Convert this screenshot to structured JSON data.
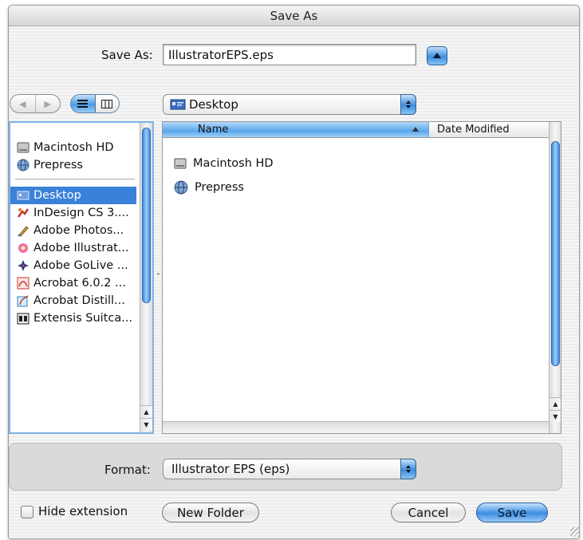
{
  "window": {
    "title": "Save As"
  },
  "save_as": {
    "label": "Save As:",
    "value": "IllustratorEPS.eps"
  },
  "location": {
    "selected": "Desktop"
  },
  "sidebar": {
    "volumes": [
      {
        "label": "Macintosh HD",
        "icon": "hard-drive-icon"
      },
      {
        "label": "Prepress",
        "icon": "network-volume-icon"
      }
    ],
    "places": [
      {
        "label": "Desktop",
        "icon": "desktop-icon",
        "selected": true
      },
      {
        "label": "InDesign CS 3....",
        "icon": "indesign-icon"
      },
      {
        "label": "Adobe Photos...",
        "icon": "photoshop-icon"
      },
      {
        "label": "Adobe Illustrat...",
        "icon": "illustrator-icon"
      },
      {
        "label": "Adobe GoLive ...",
        "icon": "golive-icon"
      },
      {
        "label": "Acrobat 6.0.2 ...",
        "icon": "acrobat-icon"
      },
      {
        "label": "Acrobat Distill...",
        "icon": "distiller-icon"
      },
      {
        "label": "Extensis Suitca...",
        "icon": "suitcase-icon"
      }
    ]
  },
  "browser": {
    "columns": {
      "name": "Name",
      "date_modified": "Date Modified"
    },
    "files": [
      {
        "name": "Macintosh HD",
        "icon": "hard-drive-icon"
      },
      {
        "name": "Prepress",
        "icon": "network-volume-icon"
      }
    ]
  },
  "format": {
    "label": "Format:",
    "selected": "Illustrator EPS (eps)"
  },
  "footer": {
    "hide_extension_label": "Hide extension",
    "hide_extension_checked": false,
    "new_folder_label": "New Folder",
    "cancel_label": "Cancel",
    "save_label": "Save"
  },
  "colors": {
    "accent": "#3a81d9",
    "selection": "#3a81d9"
  }
}
